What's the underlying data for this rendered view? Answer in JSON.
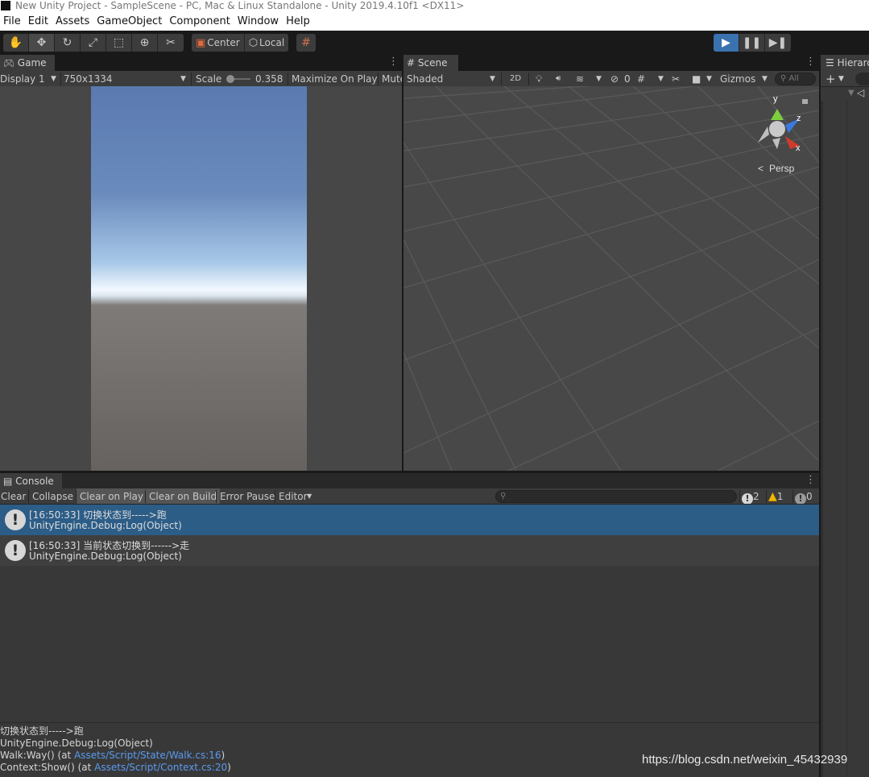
{
  "window": {
    "title": "New Unity Project - SampleScene - PC, Mac & Linux Standalone - Unity 2019.4.10f1 <DX11>"
  },
  "menu": [
    "File",
    "Edit",
    "Assets",
    "GameObject",
    "Component",
    "Window",
    "Help"
  ],
  "toolbar": {
    "tools": [
      "hand-tool-icon",
      "move-tool-icon",
      "rotate-tool-icon",
      "scale-tool-icon",
      "rect-tool-icon",
      "transform-tool-icon",
      "custom-tool-icon"
    ],
    "pivot_label": "Center",
    "space_label": "Local",
    "playing": true
  },
  "game": {
    "tab_label": "Game",
    "display": "Display 1",
    "resolution": "750x1334",
    "scale_label": "Scale",
    "scale_value": "0.358",
    "maximize_label": "Maximize On Play",
    "mute_label": "Mute"
  },
  "scene": {
    "tab_label": "Scene",
    "shading": "Shaded",
    "mode_2d": "2D",
    "hidden_count": "0",
    "gizmos_label": "Gizmos",
    "search_placeholder": "All",
    "gizmo_y": "y",
    "gizmo_z": "z",
    "gizmo_x": "x",
    "persp_label": "Persp"
  },
  "hierarchy": {
    "tab_label": "Hierarchy"
  },
  "console": {
    "tab_label": "Console",
    "buttons": [
      "Clear",
      "Collapse",
      "Clear on Play",
      "Clear on Build",
      "Error Pause",
      "Editor"
    ],
    "log_count": "2",
    "warn_count": "1",
    "error_count": "0",
    "entries": [
      {
        "line1": "[16:50:33] 切换状态到----->跑",
        "line2": "UnityEngine.Debug:Log(Object)",
        "selected": true
      },
      {
        "line1": "[16:50:33] 当前状态切换到------>走",
        "line2": "UnityEngine.Debug:Log(Object)",
        "selected": false
      }
    ],
    "detail": {
      "line1": "切换状态到----->跑",
      "line2": "UnityEngine.Debug:Log(Object)",
      "line3_prefix": "Walk:Way() (at ",
      "line3_link": "Assets/Script/State/Walk.cs:16",
      "line3_suffix": ")",
      "line4_prefix": "Context:Show() (at ",
      "line4_link": "Assets/Script/Context.cs:20",
      "line4_suffix": ")"
    }
  },
  "watermark": "https://blog.csdn.net/weixin_45432939",
  "colors": {
    "selection": "#2c5d87",
    "accent_play": "#3a72b0",
    "link": "#5a9bf0"
  }
}
